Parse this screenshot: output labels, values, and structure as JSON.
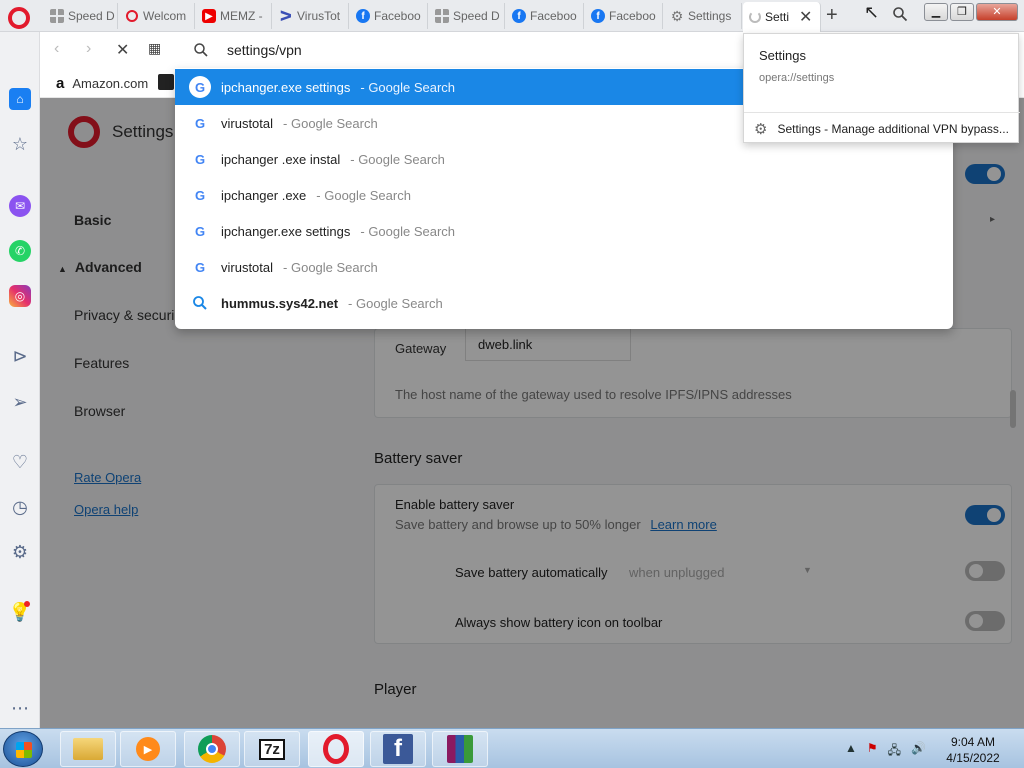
{
  "tabs": [
    {
      "label": "Speed D",
      "icon": "speed-dial-icon"
    },
    {
      "label": "Welcom",
      "icon": "opera-icon"
    },
    {
      "label": "MEMZ -",
      "icon": "youtube-icon"
    },
    {
      "label": "VirusTot",
      "icon": "virustotal-icon"
    },
    {
      "label": "Faceboo",
      "icon": "facebook-icon"
    },
    {
      "label": "Speed D",
      "icon": "speed-dial-icon"
    },
    {
      "label": "Faceboo",
      "icon": "facebook-icon"
    },
    {
      "label": "Faceboo",
      "icon": "facebook-icon"
    },
    {
      "label": "Settings",
      "icon": "gear-icon"
    },
    {
      "label": "Setti",
      "icon": "loading-spinner-icon",
      "active": true
    }
  ],
  "address_bar": {
    "value": "settings/vpn"
  },
  "bookmarks": [
    {
      "label": "Amazon.com",
      "icon": "amazon-icon"
    }
  ],
  "suggestions": [
    {
      "query": "ipchanger.exe settings",
      "source": "- Google Search",
      "selected": true
    },
    {
      "query": "virustotal",
      "source": "- Google Search"
    },
    {
      "query": "ipchanger .exe instal",
      "source": "- Google Search"
    },
    {
      "query": "ipchanger .exe",
      "source": "- Google Search"
    },
    {
      "query": "ipchanger.exe settings",
      "source": "- Google Search"
    },
    {
      "query": "virustotal",
      "source": "- Google Search"
    },
    {
      "query": "hummus.sys42.net",
      "source": "- Google Search",
      "bold": true,
      "icon": "search-icon"
    }
  ],
  "popup": {
    "title": "Settings",
    "url": "opera://settings",
    "item": "Settings - Manage additional VPN bypass..."
  },
  "settings": {
    "title": "Settings",
    "nav": {
      "basic": "Basic",
      "advanced": "Advanced",
      "privacy": "Privacy & securi",
      "features": "Features",
      "browser": "Browser",
      "rate": "Rate Opera",
      "help": "Opera help"
    },
    "gateway_label": "Gateway",
    "gateway_value": "dweb.link",
    "gateway_desc": "The host name of the gateway used to resolve IPFS/IPNS addresses",
    "battery_title": "Battery saver",
    "battery_enable": "Enable battery saver",
    "battery_desc": "Save battery and browse up to 50% longer",
    "learn_more": "Learn more",
    "save_auto": "Save battery automatically",
    "save_auto_value": "when unplugged",
    "battery_icon": "Always show battery icon on toolbar",
    "player_title": "Player"
  },
  "taskbar": {
    "apps": [
      "file-explorer-icon",
      "media-player-icon",
      "chrome-icon",
      "7zip-icon",
      "opera-icon",
      "facebook-icon",
      "winrar-icon"
    ],
    "app_7z": "7z",
    "app_fb": "f",
    "time": "9:04 AM",
    "date": "4/15/2022"
  },
  "colors": {
    "accent": "#1a87e6",
    "opera_red": "#e21a2c"
  }
}
